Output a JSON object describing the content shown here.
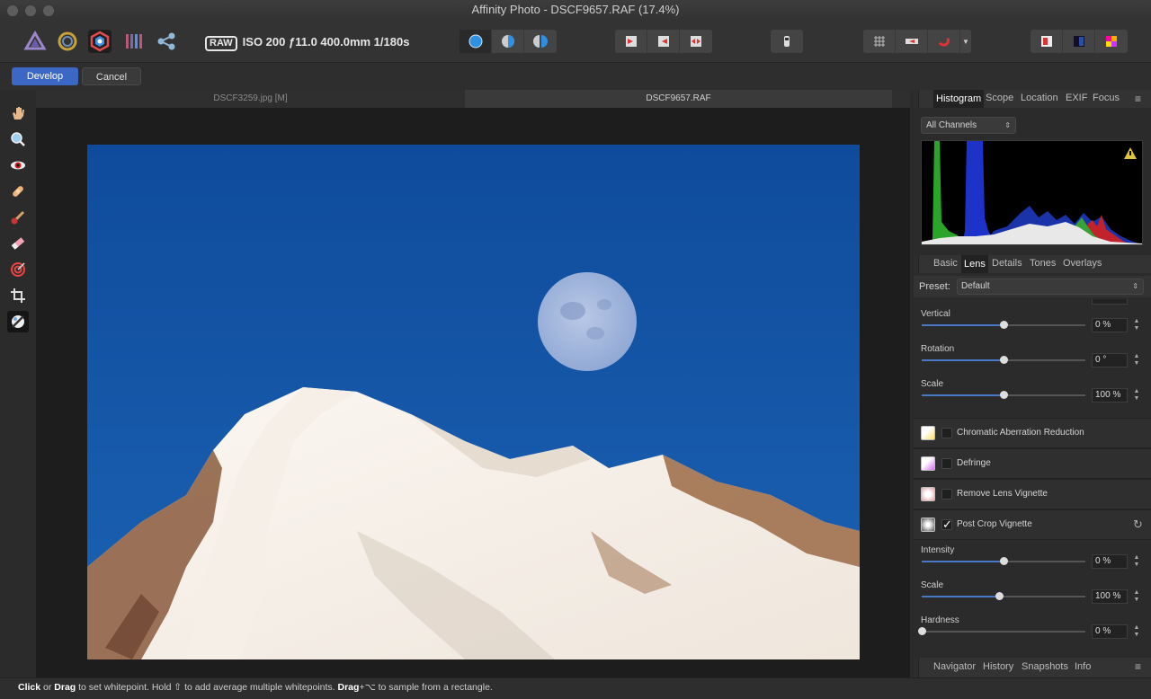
{
  "window": {
    "title": "Affinity Photo - DSCF9657.RAF (17.4%)"
  },
  "toolbar": {
    "personas": [
      "photo-persona-icon",
      "liquify-persona-icon",
      "develop-persona-icon",
      "tone-mapping-persona-icon",
      "export-persona-icon"
    ],
    "raw_badge": "RAW",
    "exif_info": "ISO 200 ƒ11.0 400.0mm 1/180s"
  },
  "develop_bar": {
    "develop_label": "Develop",
    "cancel_label": "Cancel"
  },
  "document_tabs": [
    {
      "label": "DSCF3259.jpg [M]",
      "active": false
    },
    {
      "label": "DSCF9657.RAF",
      "active": true
    }
  ],
  "histogram_panel": {
    "tabs": [
      "Histogram",
      "Scope",
      "Location",
      "EXIF",
      "Focus"
    ],
    "active_tab": "Histogram",
    "channel_select": "All Channels"
  },
  "develop_panel": {
    "tabs": [
      "Basic",
      "Lens",
      "Details",
      "Tones",
      "Overlays"
    ],
    "active_tab": "Lens",
    "preset_label": "Preset:",
    "preset_value": "Default",
    "sliders_top": [
      {
        "label": "Vertical",
        "value": "0 %",
        "position": 0.5
      },
      {
        "label": "Rotation",
        "value": "0 °",
        "position": 0.5
      },
      {
        "label": "Scale",
        "value": "100 %",
        "position": 0.5
      }
    ],
    "sections": [
      {
        "label": "Chromatic Aberration Reduction",
        "checked": false,
        "check_mark": ""
      },
      {
        "label": "Defringe",
        "checked": false,
        "check_mark": ""
      },
      {
        "label": "Remove Lens Vignette",
        "checked": false,
        "check_mark": ""
      },
      {
        "label": "Post Crop Vignette",
        "checked": true,
        "check_mark": "✓"
      }
    ],
    "sliders_vignette": [
      {
        "label": "Intensity",
        "value": "0 %",
        "position": 0.5
      },
      {
        "label": "Scale",
        "value": "100 %",
        "position": 0.47
      },
      {
        "label": "Hardness",
        "value": "0 %",
        "position": 0.0
      }
    ]
  },
  "bottom_panel": {
    "tabs": [
      "Navigator",
      "History",
      "Snapshots",
      "Info"
    ]
  },
  "status": {
    "click": "Click",
    "or": " or ",
    "drag": "Drag",
    "text1": " to set whitepoint. Hold ⇧ to add average multiple whitepoints. ",
    "drag2": "Drag",
    "text2": "+⌥ to sample from a rectangle."
  },
  "colors": {
    "accent": "#3d67c4",
    "sky": "#1a56a6"
  }
}
